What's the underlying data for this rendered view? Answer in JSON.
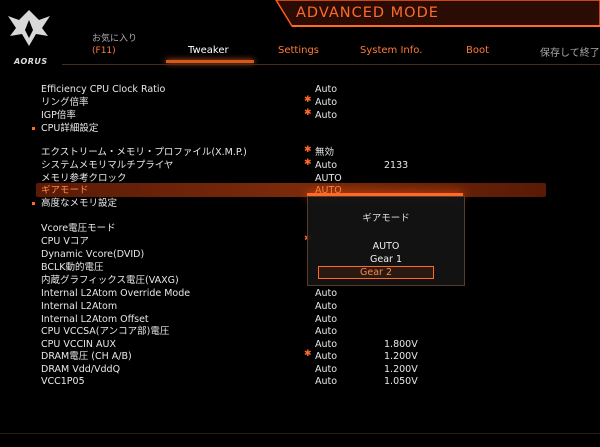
{
  "header": {
    "brand": "AORUS",
    "title": "ADVANCED MODE",
    "favorite_line1": "お気に入り",
    "favorite_line2": "(F11)",
    "save_exit": "保存して終了"
  },
  "tabs": [
    {
      "label": "Tweaker",
      "active": true
    },
    {
      "label": "Settings",
      "active": false
    },
    {
      "label": "System Info.",
      "active": false
    },
    {
      "label": "Boot",
      "active": false
    }
  ],
  "rows": [
    {
      "label": "Efficiency CPU Clock Ratio",
      "star": false,
      "value": "Auto",
      "extra": ""
    },
    {
      "label": "リング倍率",
      "star": true,
      "value": "Auto",
      "extra": ""
    },
    {
      "label": "IGP倍率",
      "star": true,
      "value": "Auto",
      "extra": ""
    },
    {
      "label": "CPU詳細設定",
      "star": false,
      "value": "",
      "extra": ""
    },
    {
      "label": "エクストリーム・メモリ・プロファイル(X.M.P.)",
      "star": true,
      "value": "無効",
      "extra": ""
    },
    {
      "label": "システムメモリマルチプライヤ",
      "star": true,
      "value": "Auto",
      "extra": "2133"
    },
    {
      "label": "メモリ参考クロック",
      "star": false,
      "value": "AUTO",
      "extra": ""
    },
    {
      "label": "ギアモード",
      "star": false,
      "value": "AUTO",
      "extra": ""
    },
    {
      "label": "高度なメモリ設定",
      "star": false,
      "value": "",
      "extra": ""
    },
    {
      "label": "Vcore電圧モード",
      "star": false,
      "value": "",
      "extra": ""
    },
    {
      "label": "CPU Vコア",
      "star": true,
      "value": "",
      "extra": ""
    },
    {
      "label": "Dynamic Vcore(DVID)",
      "star": false,
      "value": "",
      "extra": ""
    },
    {
      "label": "BCLK動的電圧",
      "star": false,
      "value": "",
      "extra": ""
    },
    {
      "label": "内蔵グラフィックス電圧(VAXG)",
      "star": false,
      "value": "",
      "extra": ""
    },
    {
      "label": "Internal L2Atom Override Mode",
      "star": false,
      "value": "Auto",
      "extra": ""
    },
    {
      "label": "Internal L2Atom",
      "star": false,
      "value": "Auto",
      "extra": ""
    },
    {
      "label": "Internal L2Atom Offset",
      "star": false,
      "value": "Auto",
      "extra": ""
    },
    {
      "label": "CPU VCCSA(アンコア部)電圧",
      "star": false,
      "value": "Auto",
      "extra": ""
    },
    {
      "label": "CPU VCCIN AUX",
      "star": false,
      "value": "Auto",
      "extra": "1.800V"
    },
    {
      "label": "DRAM電圧 (CH A/B)",
      "star": true,
      "value": "Auto",
      "extra": "1.200V"
    },
    {
      "label": "DRAM Vdd/VddQ",
      "star": false,
      "value": "Auto",
      "extra": "1.200V"
    },
    {
      "label": "VCC1P05",
      "star": false,
      "value": "Auto",
      "extra": "1.050V"
    }
  ],
  "popup": {
    "title": "ギアモード",
    "options": [
      "AUTO",
      "Gear 1",
      "Gear 2"
    ],
    "selected": "Gear 2"
  },
  "colors": {
    "accent": "#ff6a2a",
    "highlight": "#7a2a0a"
  }
}
